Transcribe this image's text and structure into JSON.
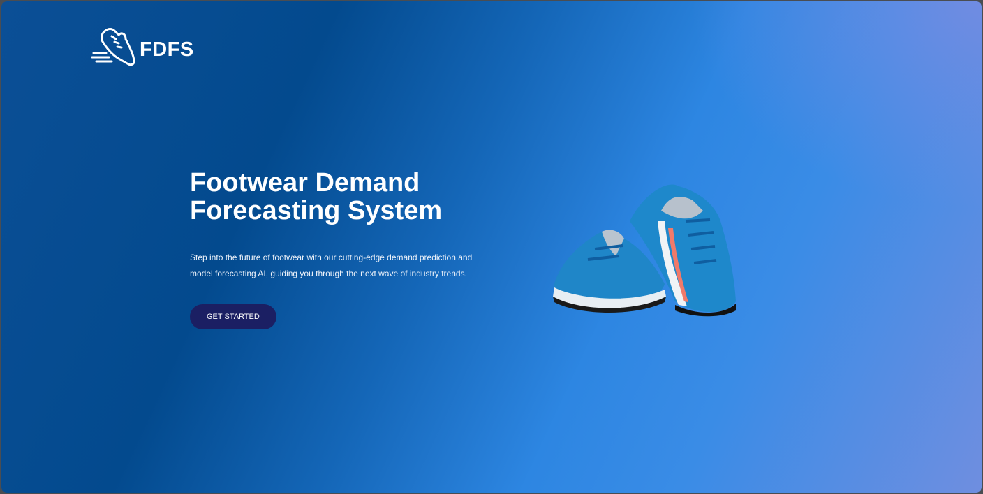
{
  "brand": {
    "name": "FDFS",
    "icon": "running-shoe-icon"
  },
  "hero": {
    "title": "Footwear Demand Forecasting System",
    "description": "Step into the future of footwear with our cutting-edge demand prediction and model forecasting AI, guiding you through the next wave of industry trends.",
    "cta_label": "GET STARTED"
  },
  "image": {
    "subject": "blue-running-shoes"
  },
  "colors": {
    "button": "#1b1f63",
    "gradient_dark": "#034a8e",
    "gradient_light": "#2d86e2",
    "gradient_corner": "#7a8fe0"
  }
}
